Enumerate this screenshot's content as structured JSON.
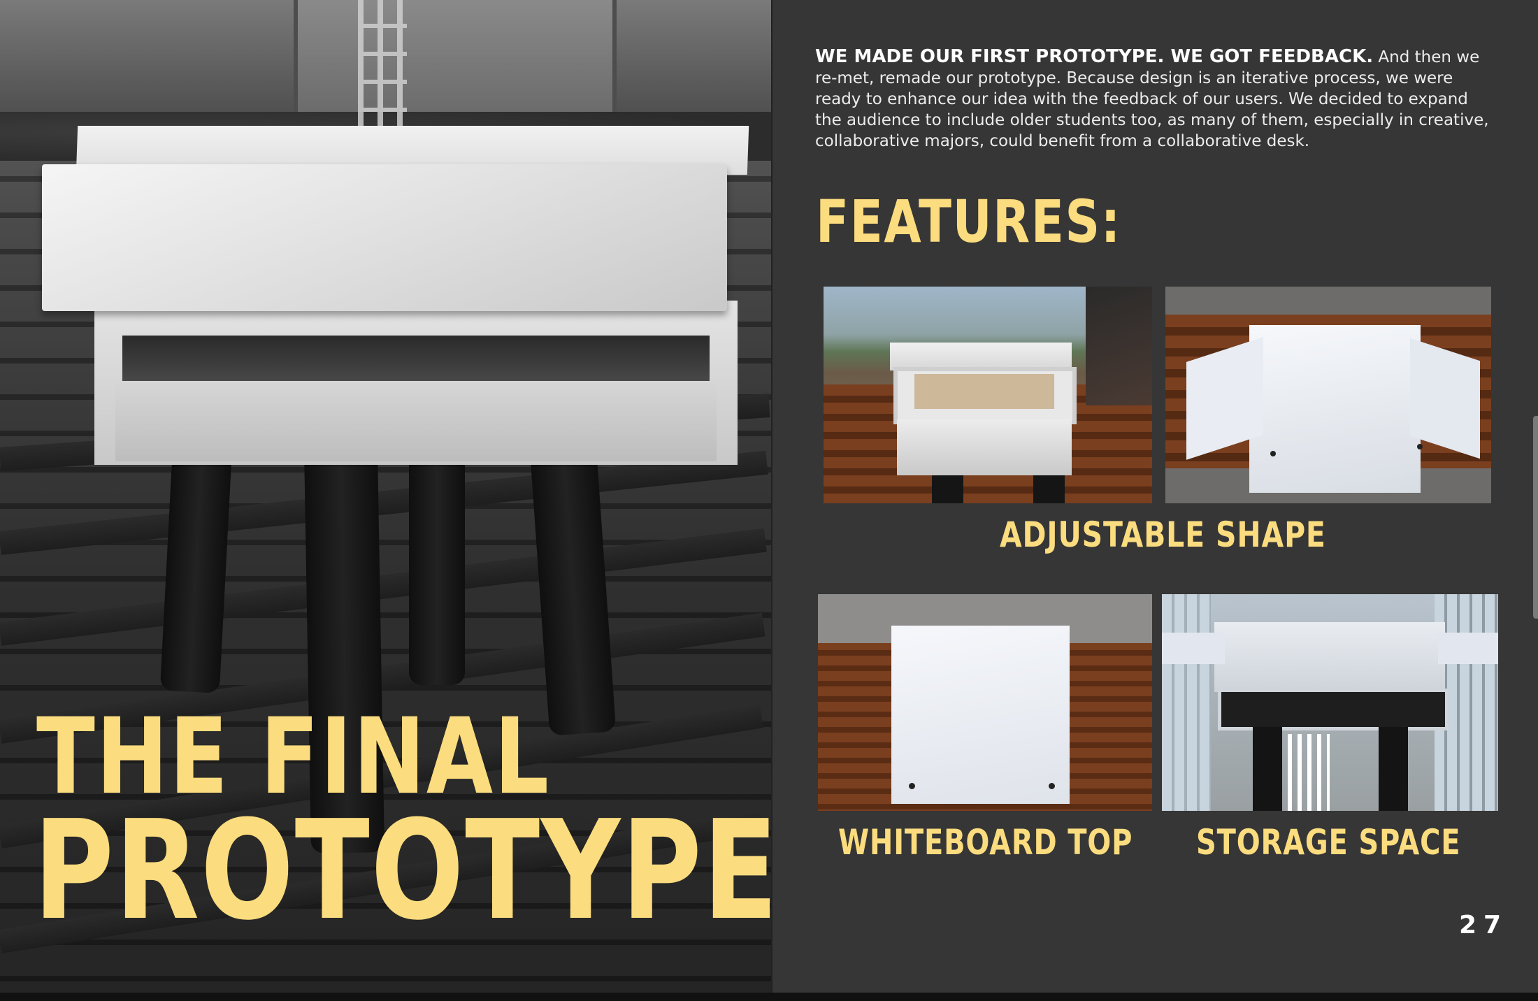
{
  "left_page": {
    "title_line1": "THE FINAL",
    "title_line2": "PROTOTYPE"
  },
  "right_page": {
    "intro_lead": "WE MADE OUR FIRST PROTOTYPE. WE GOT FEEDBACK.",
    "intro_body": "And then we re-met, remade our prototype. Because design is an iterative process, we were ready to enhance our idea with the feedback of our users. We decided to expand the audience to include older students too, as many of them, especially in creative, collaborative majors, could benefit from a collaborative desk.",
    "features_heading": "FEATURES:",
    "features": [
      {
        "label": "ADJUSTABLE SHAPE"
      },
      {
        "label": "WHITEBOARD TOP"
      },
      {
        "label": "STORAGE SPACE"
      }
    ],
    "page_number": "27"
  },
  "colors": {
    "accent_yellow": "#fbdc7e",
    "right_page_background": "#363636",
    "body_text": "#ececec"
  }
}
